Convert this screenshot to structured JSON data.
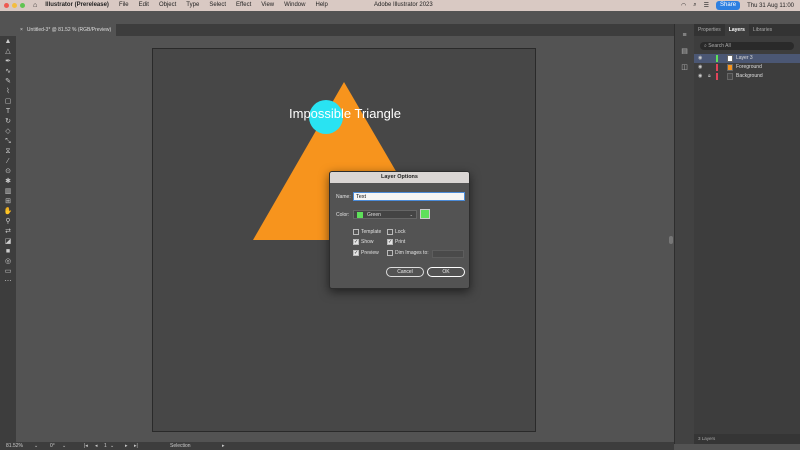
{
  "menubar": {
    "app": "Illustrator (Prerelease)",
    "items": [
      "File",
      "Edit",
      "Object",
      "Type",
      "Select",
      "Effect",
      "View",
      "Window",
      "Help"
    ],
    "window_title": "Adobe Illustrator 2023",
    "share": "Share",
    "clock": "Thu 31 Aug 11:00"
  },
  "tab": {
    "close": "×",
    "label": "Untitled-3* @ 81.52 % (RGB/Preview)"
  },
  "artwork": {
    "heading": "Impossible Triangle",
    "colors": {
      "background": "#474747",
      "triangle": "#f7941d",
      "circle": "#29e3f2"
    }
  },
  "dialog": {
    "title": "Layer Options",
    "name_label": "Name:",
    "name_value": "Text",
    "color_label": "Color:",
    "color_value": "Green",
    "color_hex": "#5ee05a",
    "template_label": "Template",
    "lock_label": "Lock",
    "show_label": "Show",
    "print_label": "Print",
    "preview_label": "Preview",
    "dim_label": "Dim Images to:",
    "checks": {
      "template": false,
      "lock": false,
      "show": true,
      "print": true,
      "preview": true,
      "dim": false
    },
    "cancel": "Cancel",
    "ok": "OK"
  },
  "panel": {
    "tabs": [
      "Properties",
      "Layers",
      "Libraries"
    ],
    "active_tab": "Layers",
    "search_placeholder": "Search All",
    "layers": [
      {
        "name": "Layer 3",
        "color": "#5ee05a"
      },
      {
        "name": "Foreground",
        "color": "#e0445a"
      },
      {
        "name": "Background",
        "color": "#e0445a"
      }
    ],
    "footer": "3 Layers"
  },
  "statusbar": {
    "zoom": "81.52%",
    "rotation": "0°",
    "artboard": "1",
    "tool": "Selection"
  }
}
